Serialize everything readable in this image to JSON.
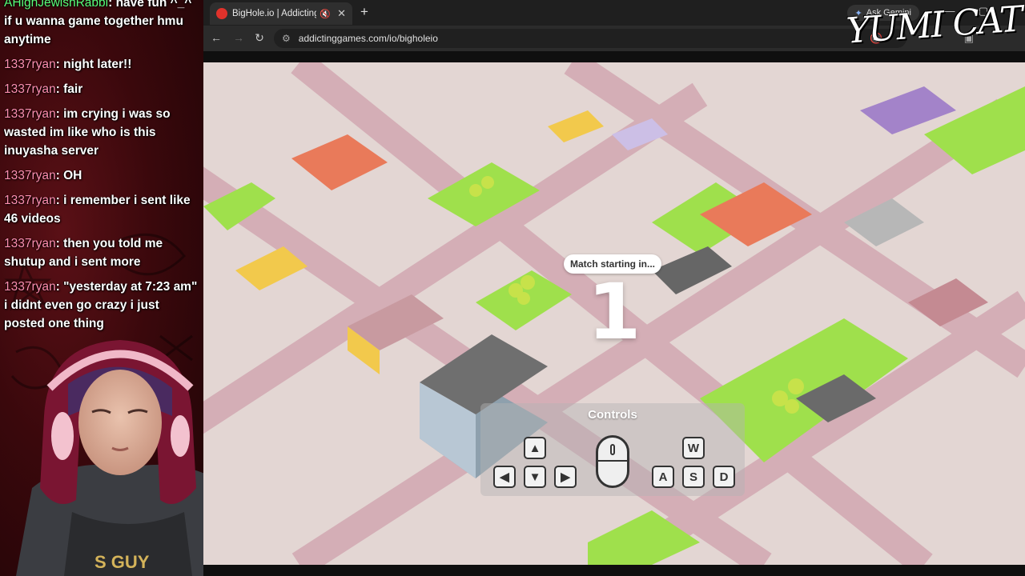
{
  "chat": {
    "messages": [
      {
        "user": "AHighJewishRabbi",
        "text": "have fun ^_^ if u wanna game together hmu anytime"
      },
      {
        "user": "1337ryan",
        "text": "night later!!"
      },
      {
        "user": "1337ryan",
        "text": "fair"
      },
      {
        "user": "1337ryan",
        "text": "im crying i was so wasted im like who is this inuyasha server"
      },
      {
        "user": "1337ryan",
        "text": "OH"
      },
      {
        "user": "1337ryan",
        "text": "i remember i sent like 46 videos"
      },
      {
        "user": "1337ryan",
        "text": "then you told me shutup and i sent more"
      },
      {
        "user": "1337ryan",
        "text": "\"yesterday at 7:23 am\" i didnt even go crazy i just posted one thing"
      }
    ],
    "username_colors": {
      "first": "#59ff7a",
      "default": "#ff8fb1"
    }
  },
  "webcam": {
    "shirt_text": "S GUY"
  },
  "browser": {
    "tab_title": "BigHole.io | Addicting Games",
    "new_tab": "+",
    "gemini_label": "Ask Gemini",
    "url": "addictinggames.com/io/bigholeio",
    "window_controls": {
      "minimize": "—",
      "maximize": "▢",
      "close": "✕"
    }
  },
  "game": {
    "match_label": "Match starting in...",
    "countdown": "1",
    "controls_title": "Controls",
    "keys": {
      "up": "▲",
      "left": "◀",
      "down": "▼",
      "right": "▶",
      "w": "W",
      "a": "A",
      "s": "S",
      "d": "D"
    },
    "mouse_icon_text": "0"
  },
  "watermark": "YUMI CAT",
  "colors": {
    "grass": "#9be04a",
    "road": "#d9b3b8",
    "ground": "#e6d9d6"
  }
}
